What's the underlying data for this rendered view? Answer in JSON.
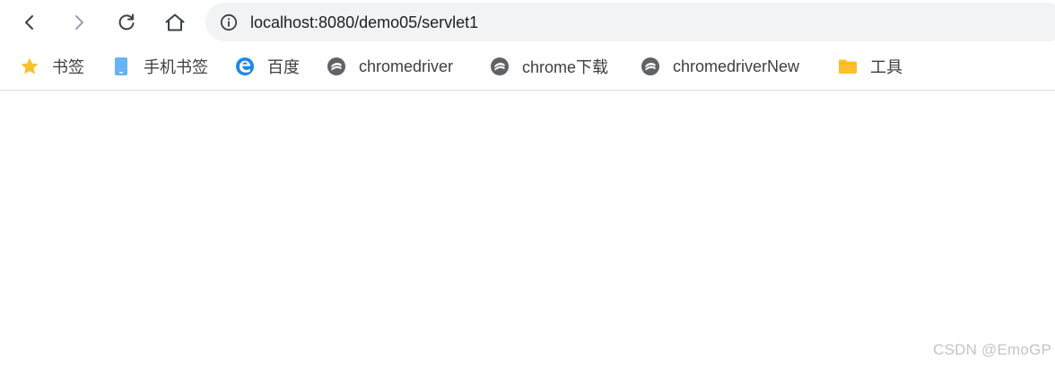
{
  "nav": {
    "back_icon": "chevron-left-icon",
    "forward_icon": "chevron-right-icon",
    "reload_icon": "reload-icon",
    "home_icon": "home-icon"
  },
  "omnibox": {
    "url": "localhost:8080/demo05/servlet1",
    "site_info_icon": "info-icon",
    "background_color": "#f1f3f4"
  },
  "bookmarks": [
    {
      "label": "书签",
      "icon": "star-icon",
      "color": "#fbc02d"
    },
    {
      "label": "手机书签",
      "icon": "mobile-icon",
      "color": "#64b5f6"
    },
    {
      "label": "百度",
      "icon": "edge-icon",
      "color": "#1e88e5"
    },
    {
      "label": "chromedriver",
      "icon": "globe-icon",
      "color": "#5f6368"
    },
    {
      "label": "chrome下载",
      "icon": "globe-icon",
      "color": "#5f6368"
    },
    {
      "label": "chromedriverNew",
      "icon": "globe-icon",
      "color": "#5f6368"
    },
    {
      "label": "工具",
      "icon": "folder-icon",
      "color": "#fbc02d"
    }
  ],
  "watermark": "CSDN @EmoGP"
}
